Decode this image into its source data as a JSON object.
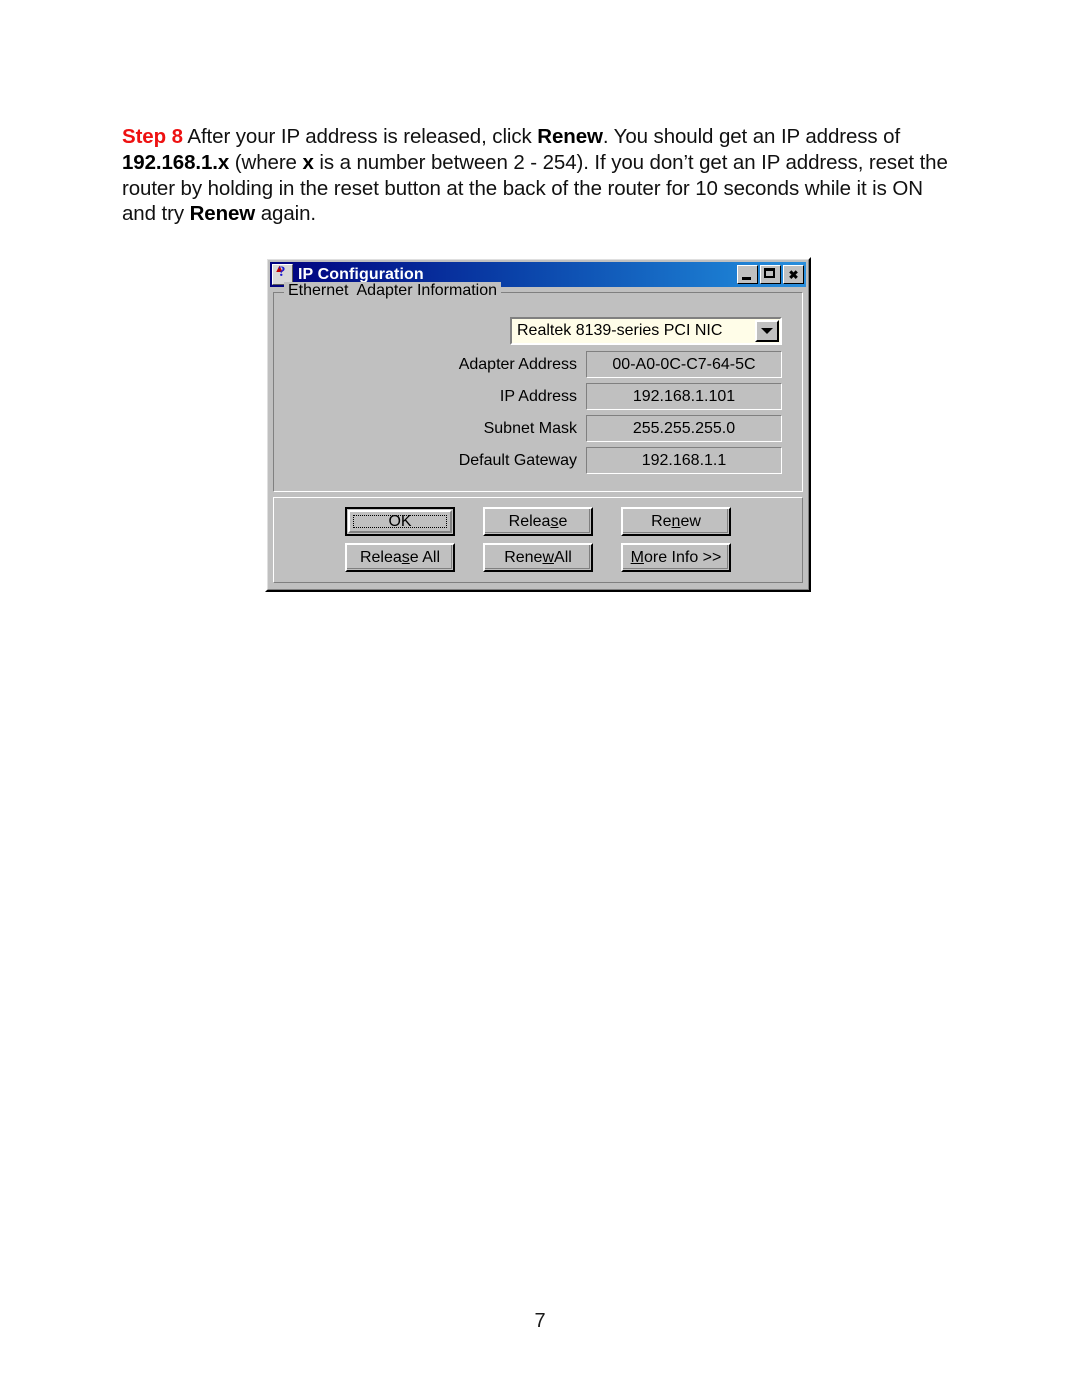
{
  "document": {
    "page_number": "7",
    "paragraph": {
      "step_label": "Step 8",
      "seg1": " After your IP address is released, click ",
      "bold_renew_1": "Renew",
      "seg2": ". You should get an IP address of ",
      "bold_ip": "192.168.1.x",
      "seg3": " (where ",
      "bold_x": "x",
      "seg4": " is a number between 2 - 254). If you don’t get an IP address, reset the router by holding in the reset button at the back of the router for 10 seconds while it is ON and try ",
      "bold_renew_2": "Renew",
      "seg5": " again."
    }
  },
  "dialog": {
    "title": "IP Configuration",
    "icon_name": "ip-config-icon",
    "window_buttons": {
      "minimize": "minimize",
      "maximize": "maximize",
      "close": "close"
    },
    "group": {
      "legend": "Ethernet  Adapter Information",
      "adapter_select": {
        "value": "Realtek 8139-series PCI NIC"
      },
      "fields": [
        {
          "label": "Adapter Address",
          "value": "00-A0-0C-C7-64-5C"
        },
        {
          "label": "IP Address",
          "value": "192.168.1.101"
        },
        {
          "label": "Subnet Mask",
          "value": "255.255.255.0"
        },
        {
          "label": "Default Gateway",
          "value": "192.168.1.1"
        }
      ]
    },
    "buttons": {
      "ok": "OK",
      "release_pre": "Relea",
      "release_accel": "s",
      "release_post": "e",
      "renew_pre": "Re",
      "renew_accel": "n",
      "renew_post": "ew",
      "release_all_pre": "Relea",
      "release_all_accel": "s",
      "release_all_post": "e All",
      "renew_all_pre": "Rene",
      "renew_all_accel": "w",
      "renew_all_post": " All",
      "more_info_accel": "M",
      "more_info_post": "ore Info >>"
    }
  },
  "colors": {
    "step_label": "#ee1111",
    "dialog_face": "#c0c0c0",
    "titlebar_start": "#00007e",
    "titlebar_end": "#2a8fdd",
    "combo_background": "#fffde8"
  }
}
